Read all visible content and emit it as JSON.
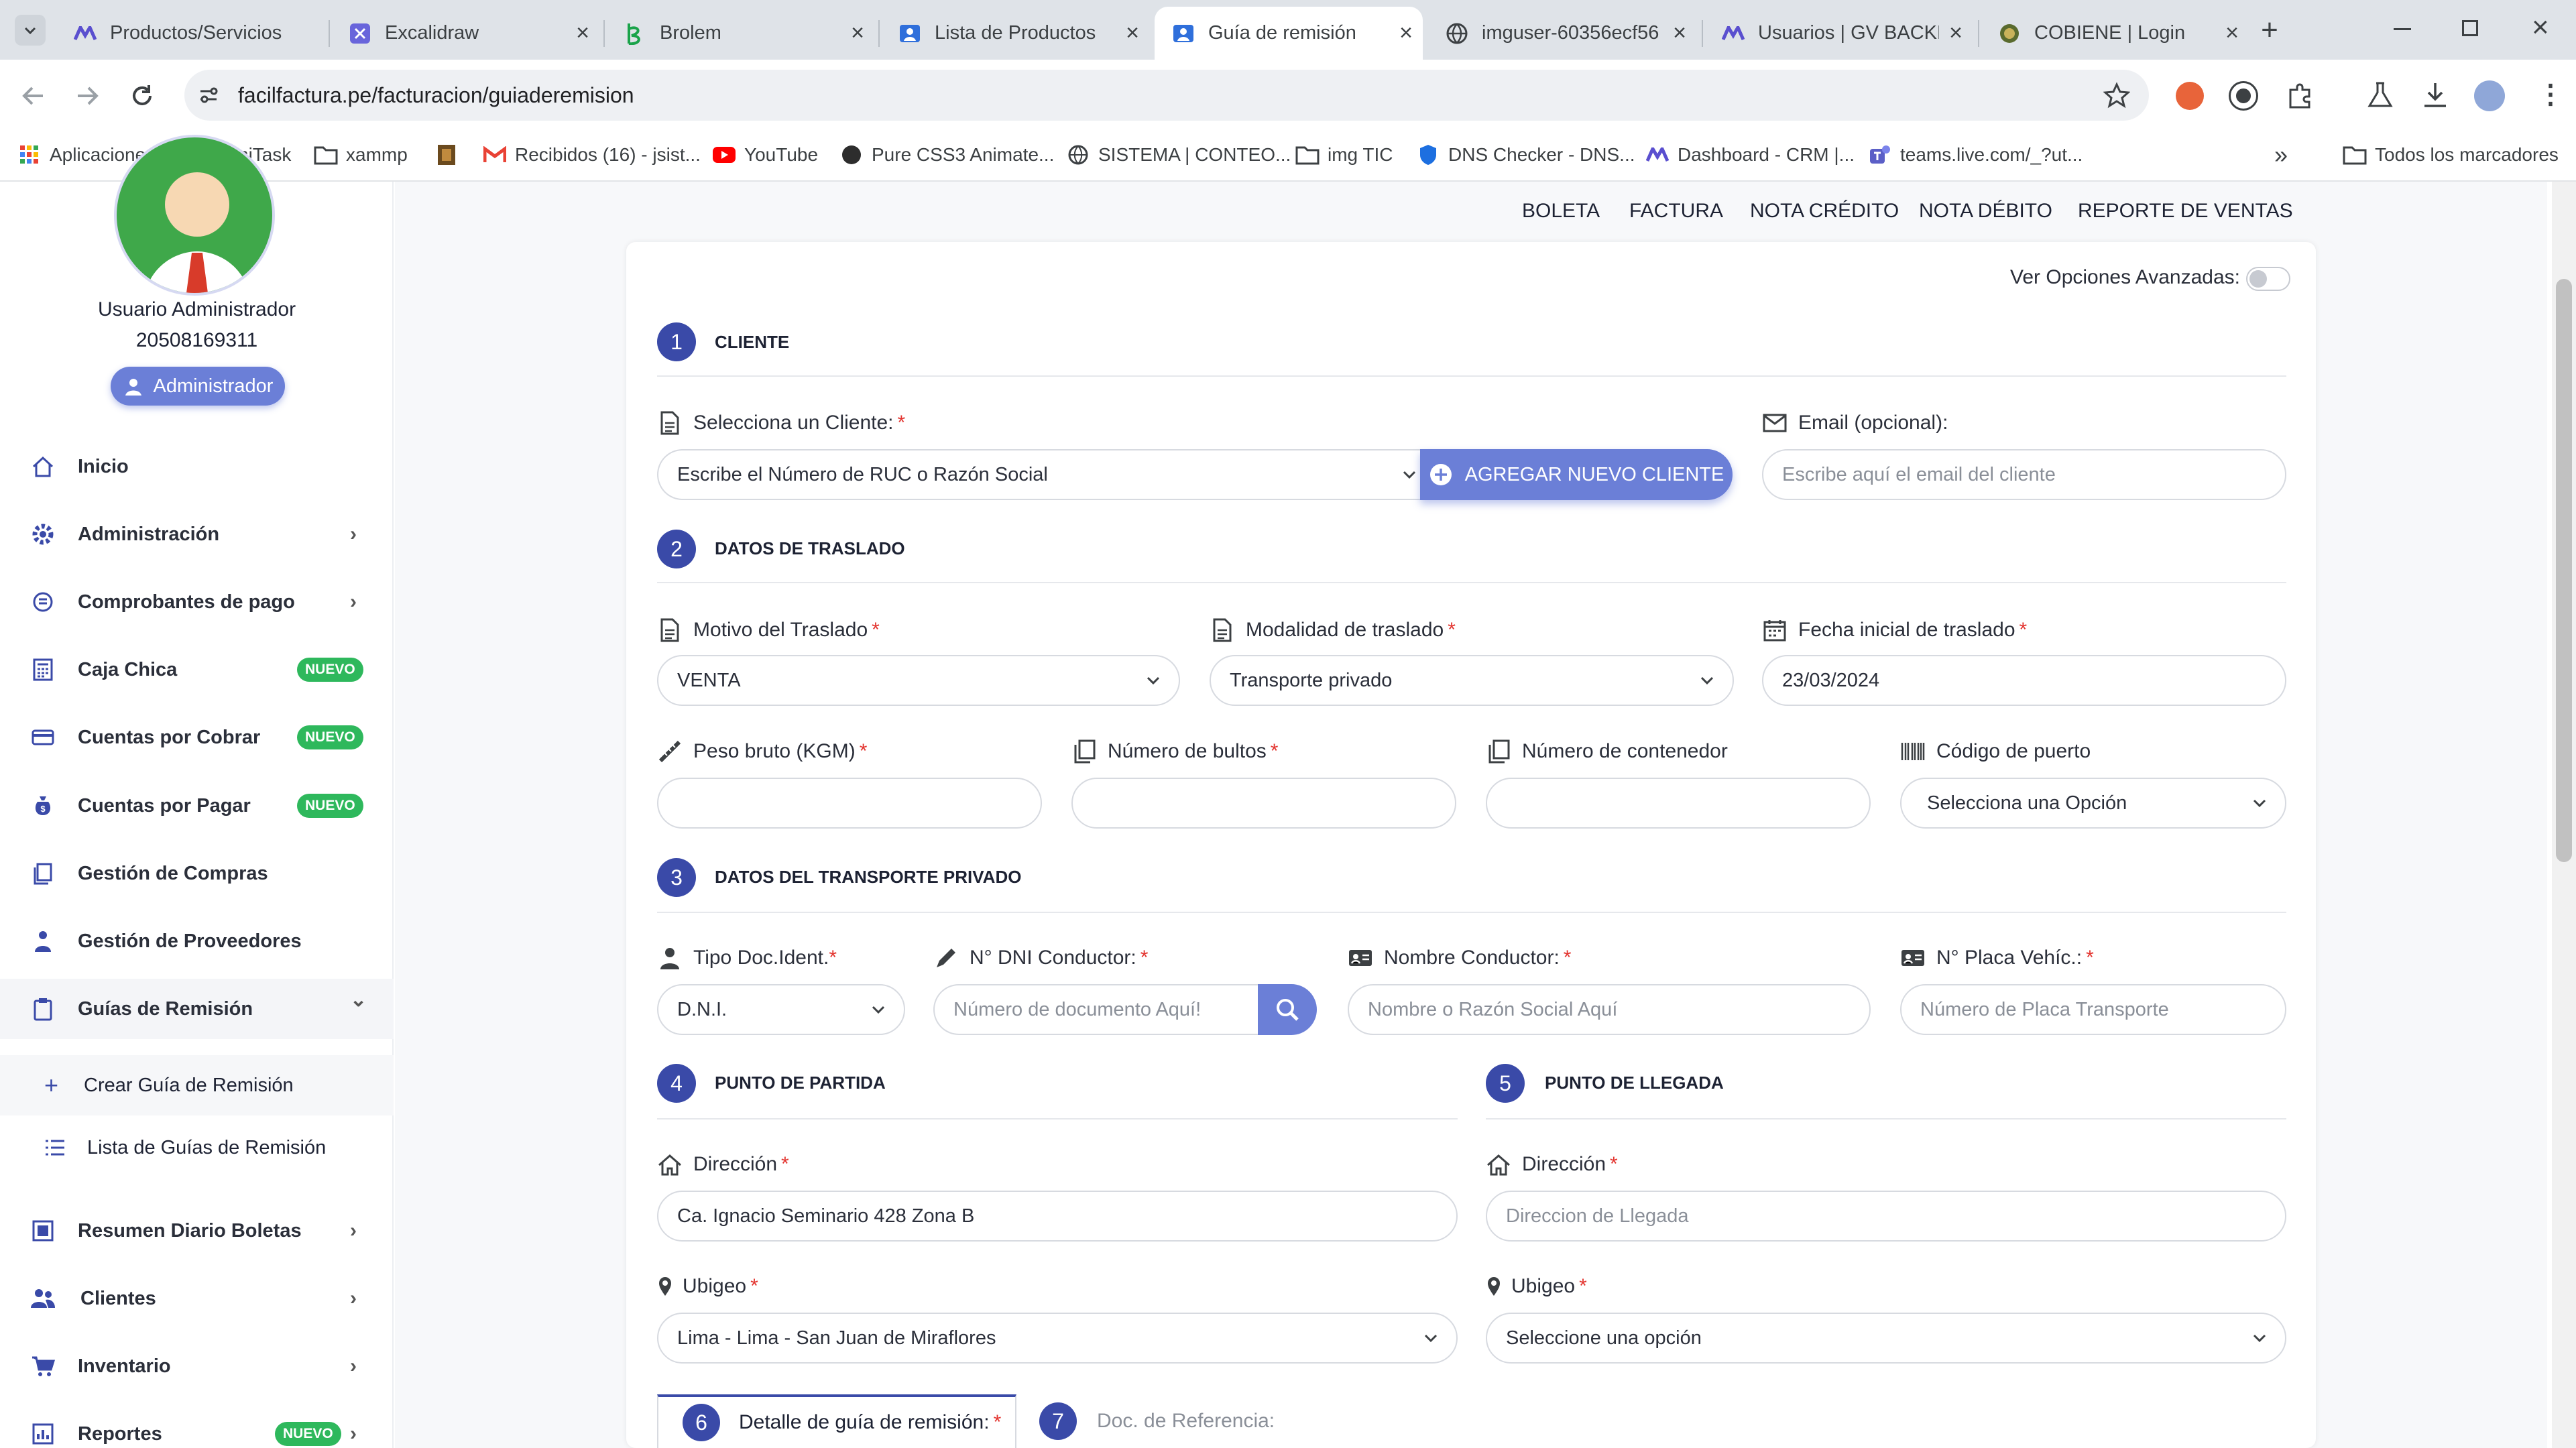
{
  "tabs": [
    {
      "title": "Productos/Servicios",
      "icon": "logo-m-icon"
    },
    {
      "title": "Excalidraw",
      "icon": "excalidraw-icon"
    },
    {
      "title": "Brolem",
      "icon": "brolem-icon"
    },
    {
      "title": "Lista de Productos",
      "icon": "user-icon"
    },
    {
      "title": "Guía de remisión",
      "icon": "user-icon"
    },
    {
      "title": "imguser-60356ecf56",
      "icon": "globe-icon"
    },
    {
      "title": "Usuarios | GV BACKE",
      "icon": "logo-m-icon"
    },
    {
      "title": "COBIENE | Login",
      "icon": "cobiene-icon"
    }
  ],
  "url": "facilfactura.pe/facturacion/guiaderemision",
  "bookmarks": [
    "Aplicaciones",
    "SamiTask",
    "xammp",
    "Recibidos (16) - jsist...",
    "YouTube",
    "Pure CSS3 Animate...",
    "SISTEMA | CONTEO...",
    "img TIC",
    "DNS Checker - DNS...",
    "Dashboard - CRM |...",
    "teams.live.com/_?ut...",
    "Todos los marcadores"
  ],
  "user": {
    "name": "Usuario Administrador",
    "ruc": "20508169311",
    "role": "Administrador"
  },
  "nav": [
    {
      "label": "Inicio",
      "icon": "home-icon",
      "chevron": ""
    },
    {
      "label": "Administración",
      "icon": "gear-icon",
      "chevron": "›"
    },
    {
      "label": "Comprobantes de pago",
      "icon": "receipt-icon",
      "chevron": "›"
    },
    {
      "label": "Caja Chica",
      "icon": "calculator-icon",
      "badge": "NUEVO"
    },
    {
      "label": "Cuentas por Cobrar",
      "icon": "card-icon",
      "badge": "NUEVO"
    },
    {
      "label": "Cuentas por Pagar",
      "icon": "moneybag-icon",
      "badge": "NUEVO"
    },
    {
      "label": "Gestión de Compras",
      "icon": "copy-icon"
    },
    {
      "label": "Gestión de Proveedores",
      "icon": "person-icon"
    },
    {
      "label": "Guías de Remisión",
      "icon": "clipboard-icon",
      "chevron": "⌄"
    },
    {
      "label": "Resumen Diario Boletas",
      "icon": "summary-icon",
      "chevron": "›"
    },
    {
      "label": "Clientes",
      "icon": "users-icon",
      "chevron": "›"
    },
    {
      "label": "Inventario",
      "icon": "cart-icon",
      "chevron": "›"
    },
    {
      "label": "Reportes",
      "icon": "report-icon",
      "chevron": "›",
      "badge": "NUEVO"
    }
  ],
  "subnav": [
    "Crear Guía de Remisión",
    "Lista de Guías de Remisión"
  ],
  "topnav": [
    "BOLETA",
    "FACTURA",
    "NOTA CRÉDITO",
    "NOTA DÉBITO",
    "REPORTE DE VENTAS"
  ],
  "advanced_label": "Ver Opciones Avanzadas:",
  "sections": {
    "s1": {
      "num": "1",
      "title": "CLIENTE"
    },
    "s2": {
      "num": "2",
      "title": "DATOS DE TRASLADO"
    },
    "s3": {
      "num": "3",
      "title": "DATOS DEL TRANSPORTE PRIVADO"
    },
    "s4": {
      "num": "4",
      "title": "PUNTO DE PARTIDA"
    },
    "s5": {
      "num": "5",
      "title": "PUNTO DE LLEGADA"
    },
    "s6": {
      "num": "6",
      "title": "Detalle de guía de remisión:"
    },
    "s7": {
      "num": "7",
      "title": "Doc. de Referencia:"
    }
  },
  "cliente": {
    "label": "Selecciona un Cliente:",
    "value": "Escribe el Número de RUC o Razón Social",
    "add_button": "AGREGAR NUEVO CLIENTE",
    "email_label": "Email (opcional):",
    "email_placeholder": "Escribe aquí el email del cliente"
  },
  "traslado": {
    "motivo_label": "Motivo del Traslado",
    "motivo_value": "VENTA",
    "modalidad_label": "Modalidad de traslado",
    "modalidad_value": "Transporte privado",
    "fecha_label": "Fecha inicial de traslado",
    "fecha_value": "23/03/2024",
    "peso_label": "Peso bruto (KGM)",
    "bultos_label": "Número de bultos",
    "contenedor_label": "Número de contenedor",
    "puerto_label": "Código de puerto",
    "puerto_value": "Selecciona una Opción"
  },
  "transporte": {
    "tipo_label": "Tipo Doc.Ident.",
    "tipo_value": "D.N.I.",
    "dni_label": "N° DNI Conductor:",
    "dni_placeholder": "Número de documento Aquí!",
    "nombre_label": "Nombre Conductor:",
    "nombre_placeholder": "Nombre o Razón Social Aquí",
    "placa_label": "N° Placa Vehíc.:",
    "placa_placeholder": "Número de Placa Transporte"
  },
  "partida": {
    "dir_label": "Dirección",
    "dir_value": "Ca. Ignacio Seminario 428 Zona B",
    "ubigeo_label": "Ubigeo",
    "ubigeo_value": "Lima - Lima - San Juan de Miraflores"
  },
  "llegada": {
    "dir_label": "Dirección",
    "dir_placeholder": "Direccion de Llegada",
    "ubigeo_label": "Ubigeo",
    "ubigeo_value": "Seleccione una opción"
  },
  "colors": {
    "accent": "#3a4aa8",
    "button": "#6b7fd7",
    "badge": "#2eb85c",
    "required": "#e3342f"
  }
}
